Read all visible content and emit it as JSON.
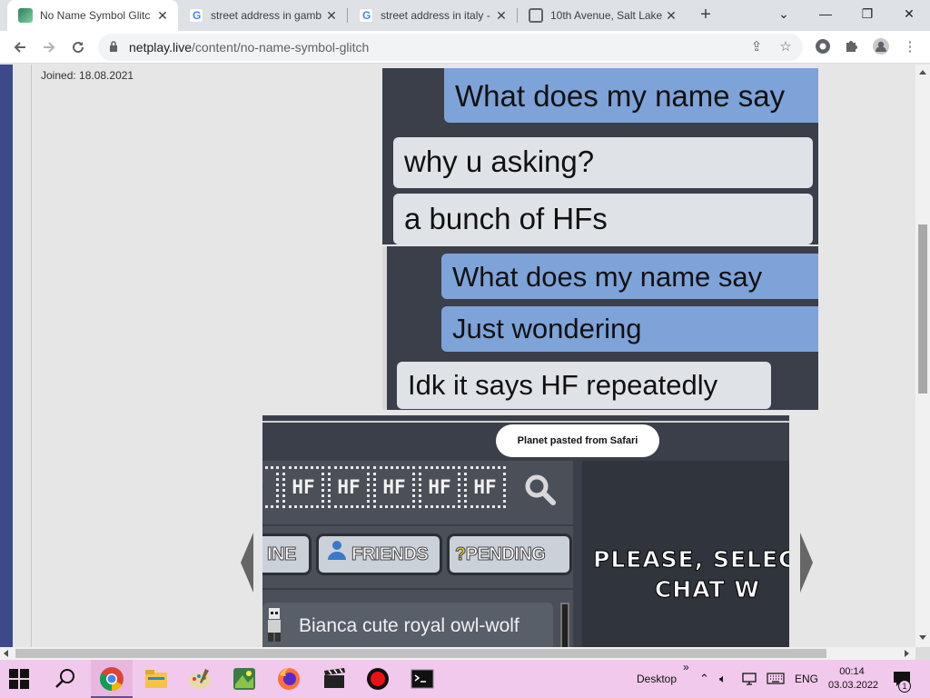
{
  "browser": {
    "tabs": [
      {
        "title": "No Name Symbol Glitc",
        "favicon": "netplay-favicon",
        "active": true
      },
      {
        "title": "street address in gamb",
        "favicon": "google-favicon",
        "active": false
      },
      {
        "title": "street address in italy -",
        "favicon": "google-favicon",
        "active": false
      },
      {
        "title": "10th Avenue, Salt Lake",
        "favicon": "globe-favicon",
        "active": false
      }
    ],
    "new_tab_label": "+",
    "window_controls": {
      "minimize": "—",
      "restore": "❐",
      "close": "✕",
      "tab_list": "⌄"
    },
    "url_domain": "netplay.live",
    "url_path": "/content/no-name-symbol-glitch"
  },
  "page": {
    "joined_label": "Joined: 18.08.2021",
    "chat1": {
      "messages": [
        {
          "text": "What does my name say",
          "style": "blue"
        },
        {
          "text": "why u asking?",
          "style": "white"
        },
        {
          "text": "a bunch of HFs",
          "style": "white"
        }
      ]
    },
    "chat2": {
      "messages": [
        {
          "text": "What does my name say",
          "style": "blue"
        },
        {
          "text": "Just wondering",
          "style": "blue"
        },
        {
          "text": "Idk it says HF repeatedly",
          "style": "white"
        }
      ]
    },
    "game": {
      "toast": "Planet pasted from Safari",
      "hf_boxes": [
        "F",
        "HF",
        "HF",
        "HF",
        "HF",
        "HF"
      ],
      "buttons": [
        {
          "label": "INE",
          "icon": ""
        },
        {
          "label": "FRIENDS",
          "icon": "person-icon"
        },
        {
          "label": "PENDING",
          "icon": "question-icon"
        }
      ],
      "list_item": "Bianca cute royal owl-wolf",
      "select_text": "PLEASE, SELECT\n       CHAT W"
    }
  },
  "taskbar": {
    "desktop_label": "Desktop",
    "overflow_label": "»",
    "lang": "ENG",
    "time": "00:14",
    "date": "03.03.2022",
    "notification_count": "1"
  },
  "colors": {
    "tab_strip": "#dee1e6",
    "taskbar": "#f1c9ec",
    "chat_bg": "#3a3f4a",
    "bubble_blue": "#7da3d8",
    "bubble_white": "#dfe3e8"
  }
}
